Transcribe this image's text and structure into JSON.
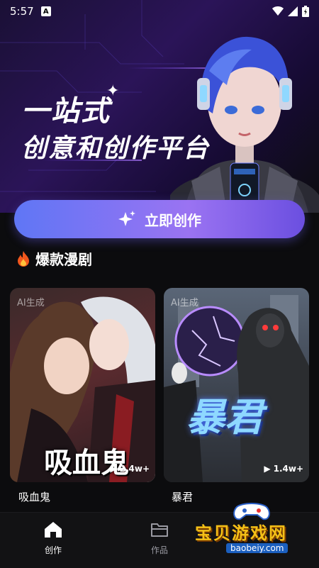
{
  "status_bar": {
    "time": "5:57",
    "app_badge": "A"
  },
  "hero": {
    "title_line1": "一站式",
    "title_line2": "创意和创作平台"
  },
  "cta": {
    "label": "立即创作"
  },
  "section": {
    "title": "爆款漫剧"
  },
  "cards": [
    {
      "badge": "AI生成",
      "art_title": "吸血鬼",
      "plays": "2.4w+",
      "caption": "吸血鬼"
    },
    {
      "badge": "AI生成",
      "art_title": "暴君",
      "plays": "1.4w+",
      "caption": "暴君"
    }
  ],
  "tabs": [
    {
      "label": "创作",
      "icon": "home-icon",
      "active": true
    },
    {
      "label": "作品",
      "icon": "folder-icon",
      "active": false
    }
  ],
  "watermark": {
    "text": "宝贝游戏网",
    "url": "baobeiy.com"
  },
  "colors": {
    "accent_start": "#5f76f5",
    "accent_end": "#9a73f2",
    "background": "#0c0c0e"
  }
}
